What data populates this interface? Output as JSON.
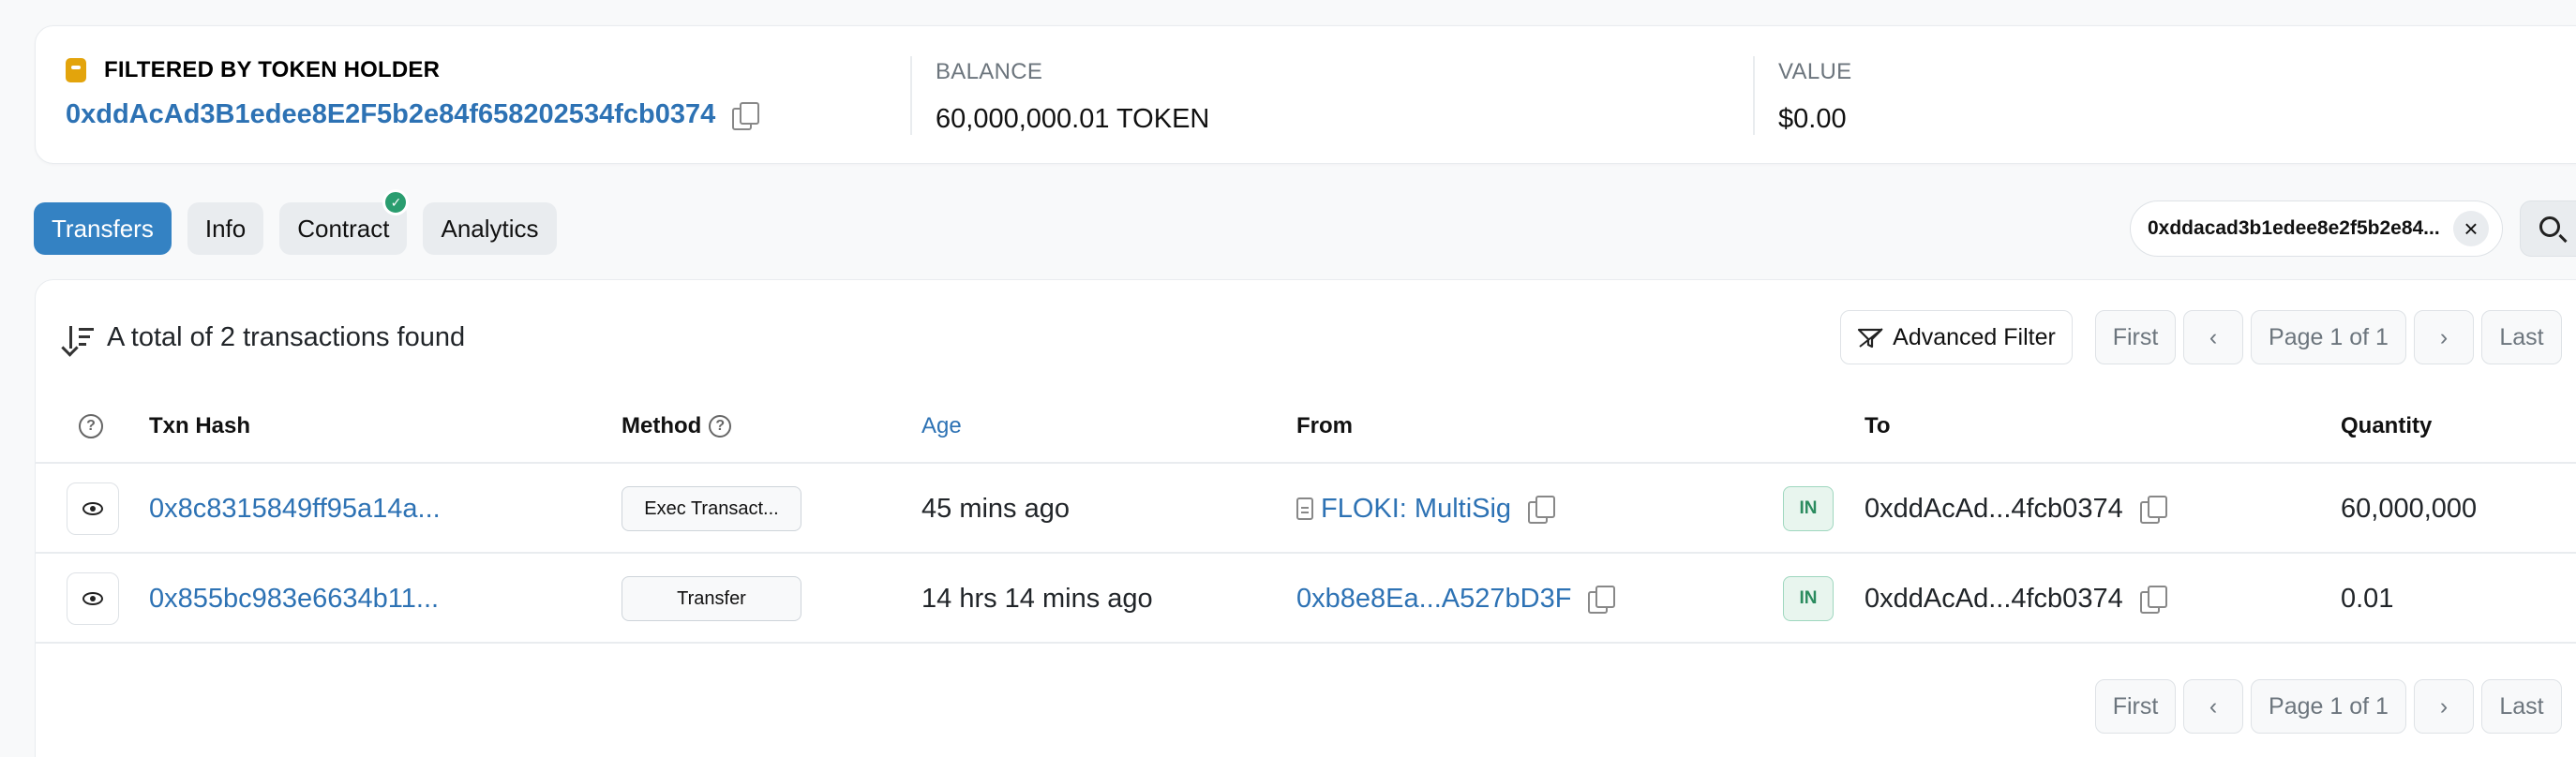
{
  "summary": {
    "filter_label": "FILTERED BY TOKEN HOLDER",
    "holder_address": "0xddAcAd3B1edee8E2F5b2e84f658202534fcb0374",
    "balance_label": "BALANCE",
    "balance_value": "60,000,000.01 TOKEN",
    "value_label": "VALUE",
    "value_value": "$0.00"
  },
  "tabs": [
    {
      "label": "Transfers",
      "active": true
    },
    {
      "label": "Info",
      "active": false
    },
    {
      "label": "Contract",
      "active": false,
      "verified": true
    },
    {
      "label": "Analytics",
      "active": false
    }
  ],
  "search": {
    "value": "0xddacad3b1edee8e2f5b2e84..."
  },
  "table": {
    "total_text": "A total of 2 transactions found",
    "advanced_filter": "Advanced Filter",
    "pager": {
      "first": "First",
      "page": "Page 1 of 1",
      "last": "Last"
    },
    "headers": {
      "txn_hash": "Txn Hash",
      "method": "Method",
      "age": "Age",
      "from": "From",
      "to": "To",
      "quantity": "Quantity"
    },
    "rows": [
      {
        "txn_hash": "0x8c8315849ff95a14a...",
        "method": "Exec Transact...",
        "age": "45 mins ago",
        "from": "FLOKI: MultiSig",
        "direction": "IN",
        "to": "0xddAcAd...4fcb0374",
        "quantity": "60,000,000"
      },
      {
        "txn_hash": "0x855bc983e6634b11...",
        "method": "Transfer",
        "age": "14 hrs 14 mins ago",
        "from": "0xb8e8Ea...A527bD3F",
        "direction": "IN",
        "to": "0xddAcAd...4fcb0374",
        "quantity": "0.01"
      }
    ]
  },
  "colors": {
    "accent": "#3482c3",
    "link": "#2d72b4",
    "in_badge": "#2a8b5e",
    "holder_tag": "#e3a40c"
  }
}
